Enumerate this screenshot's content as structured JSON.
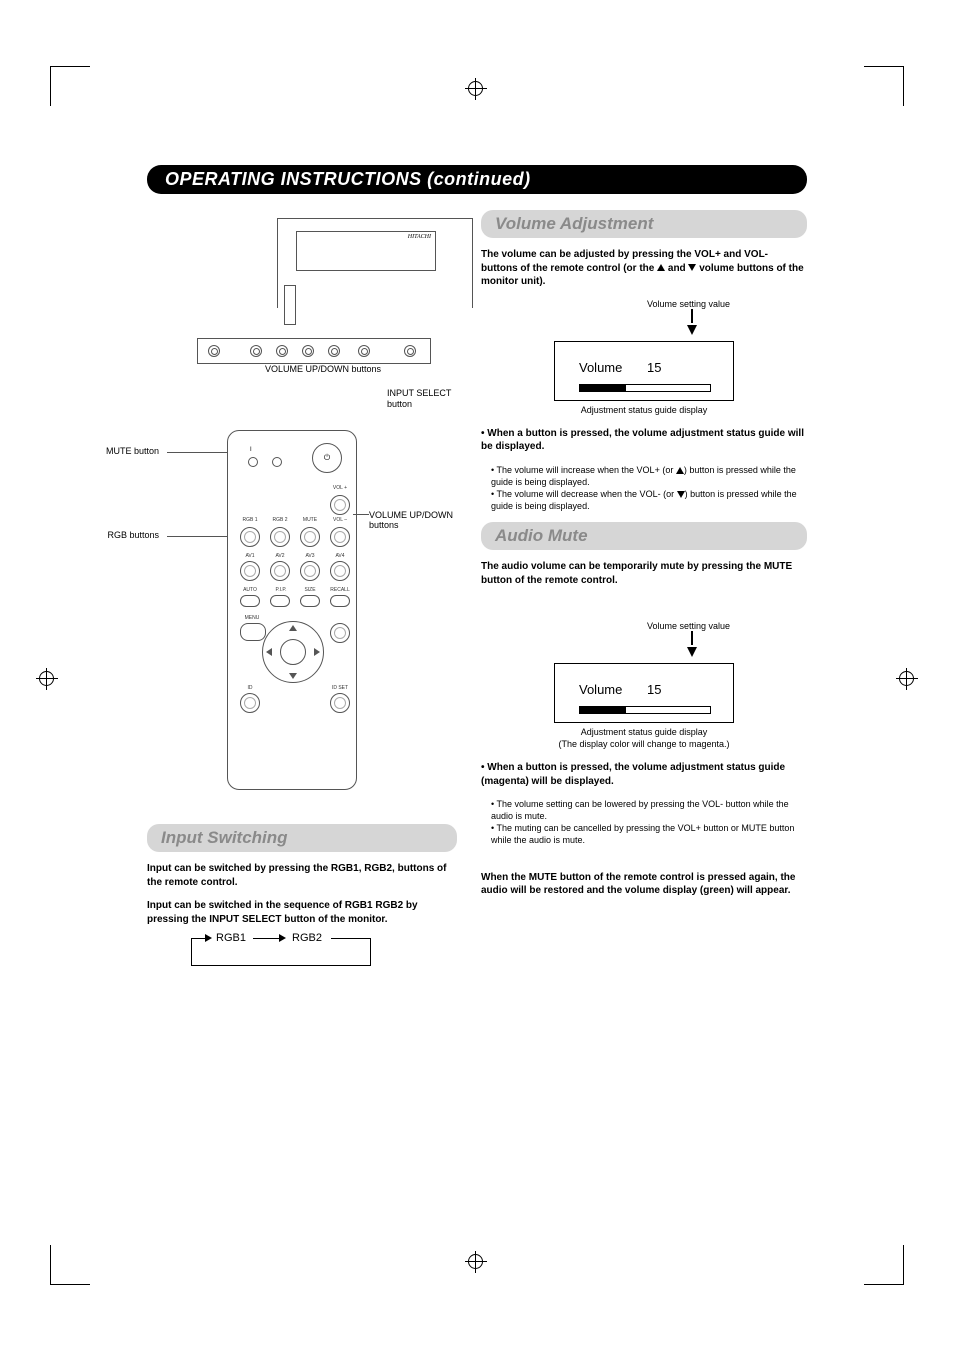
{
  "title": "OPERATING INSTRUCTIONS (continued)",
  "monitor": {
    "logo": "HITACHI",
    "callout_volume": "VOLUME UP/DOWN buttons",
    "callout_input": "INPUT SELECT button"
  },
  "remote": {
    "label_mute": "MUTE button",
    "label_rgb": "RGB buttons",
    "label_volume": "VOLUME UP/DOWN buttons",
    "power": "",
    "led_on": "I",
    "led_standby": "",
    "row0": {
      "volplus": "VOL +",
      "volminus": "VOL –"
    },
    "row1": {
      "b1": "RGB 1",
      "b2": "RGB 2",
      "b3": "MUTE",
      "b4": ""
    },
    "row2": {
      "b1": "AV1",
      "b2": "AV2",
      "b3": "AV3",
      "b4": "AV4"
    },
    "row3": {
      "o1": "AUTO",
      "o2": "P.I.P.",
      "o3": "SIZE",
      "o4": "RECALL"
    },
    "menu": "MENU",
    "id_no": "ID",
    "id_set": "ID SET"
  },
  "input_switching": {
    "header": "Input Switching",
    "p1": "Input can be switched by pressing the RGB1, RGB2, buttons of the remote control.",
    "p2": "Input can be switched in the sequence of RGB1 RGB2 by pressing the INPUT SELECT button of the monitor.",
    "flow_rgb1": "RGB1",
    "flow_rgb2": "RGB2"
  },
  "volume_adjustment": {
    "header": "Volume Adjustment",
    "intro_a": "The volume can be adjusted by pressing the VOL+ and VOL- buttons of the remote control (or the ",
    "intro_b": " and ",
    "intro_c": " volume buttons of the monitor unit).",
    "pointer_label": "Volume setting value",
    "display_label": "Volume",
    "display_value": "15",
    "caption": "Adjustment status guide display",
    "bullet_head": "• When a button is pressed, the volume adjustment status guide will be displayed.",
    "sub1_a": "• The volume will increase when the VOL+ (or ",
    "sub1_b": ") button is pressed while the guide is being displayed.",
    "sub2_a": "• The volume will decrease when the VOL- (or ",
    "sub2_b": ") button is pressed while the guide is being displayed."
  },
  "audio_mute": {
    "header": "Audio Mute",
    "intro": "The audio volume can be temporarily mute by pressing the MUTE button of the remote control.",
    "pointer_label": "Volume setting value",
    "display_label": "Volume",
    "display_value": "15",
    "caption1": "Adjustment status guide display",
    "caption2": "(The display color will change to magenta.)",
    "bullet_head": "• When a button is pressed, the volume adjustment status guide (magenta) will be displayed.",
    "sub1": "• The volume setting can be lowered by pressing the VOL- button while the audio is mute.",
    "sub2": "• The muting can be cancelled by pressing the VOL+ button or MUTE button while the audio is mute.",
    "closing": "When the MUTE button of the remote control is pressed again, the audio will be restored and the volume display (green) will appear."
  }
}
